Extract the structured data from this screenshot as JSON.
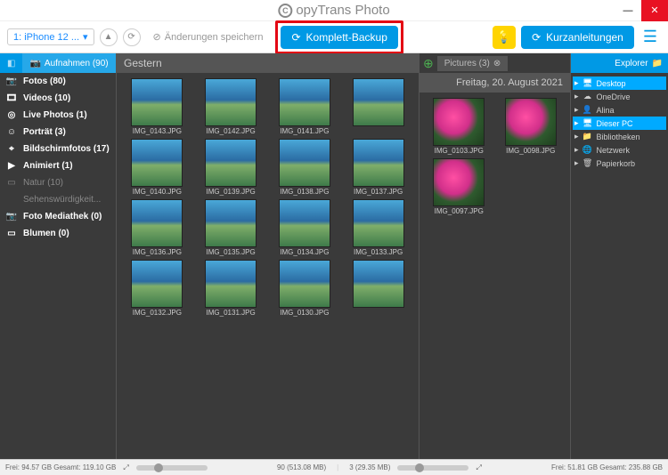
{
  "app": {
    "title": "opyTrans Photo",
    "logo": "C"
  },
  "titlebar": {
    "min": "—",
    "close": "✕"
  },
  "toolbar": {
    "device": "1: iPhone 12 ...",
    "save": "Änderungen speichern",
    "backup": "Komplett-Backup",
    "guide": "Kurzanleitungen"
  },
  "tabs": {
    "albums": "Aufnahmen (90)"
  },
  "sidebar": [
    {
      "icon": "📷",
      "label": "Fotos (80)",
      "cls": "bold"
    },
    {
      "icon": "🎞",
      "label": "Videos (10)",
      "cls": "bold"
    },
    {
      "icon": "◎",
      "label": "Live Photos (1)",
      "cls": "bold"
    },
    {
      "icon": "☺",
      "label": "Porträt (3)",
      "cls": "bold"
    },
    {
      "icon": "⌖",
      "label": "Bildschirmfotos (17)",
      "cls": "bold"
    },
    {
      "icon": "▶",
      "label": "Animiert (1)",
      "cls": "bold"
    },
    {
      "icon": "▭",
      "label": "Natur (10)",
      "cls": "dim"
    },
    {
      "icon": "",
      "label": "Sehenswürdigkeit...",
      "cls": "dim"
    },
    {
      "icon": "📷",
      "label": "Foto Mediathek (0)",
      "cls": "bold"
    },
    {
      "icon": "▭",
      "label": "Blumen (0)",
      "cls": "bold"
    }
  ],
  "gallery_left": {
    "header": "Gestern",
    "items": [
      "IMG_0143.JPG",
      "IMG_0142.JPG",
      "IMG_0141.JPG",
      "",
      "IMG_0140.JPG",
      "IMG_0139.JPG",
      "IMG_0138.JPG",
      "IMG_0137.JPG",
      "IMG_0136.JPG",
      "IMG_0135.JPG",
      "IMG_0134.JPG",
      "IMG_0133.JPG",
      "IMG_0132.JPG",
      "IMG_0131.JPG",
      "IMG_0130.JPG",
      ""
    ]
  },
  "gallery_right": {
    "tab": "Pictures (3)",
    "header": "Freitag, 20. August 2021",
    "items": [
      {
        "label": "IMG_0103.JPG",
        "type": "flower"
      },
      {
        "label": "IMG_0098.JPG",
        "type": "flower"
      },
      {
        "label": "IMG_0097.JPG",
        "type": "flower"
      }
    ]
  },
  "explorer": {
    "tab": "Explorer",
    "items": [
      {
        "icon": "🖥",
        "label": "Desktop",
        "sel": true
      },
      {
        "icon": "☁",
        "label": "OneDrive"
      },
      {
        "icon": "👤",
        "label": "Alina"
      },
      {
        "icon": "🖥",
        "label": "Dieser PC",
        "sel": true
      },
      {
        "icon": "📁",
        "label": "Bibliotheken"
      },
      {
        "icon": "🌐",
        "label": "Netzwerk"
      },
      {
        "icon": "🗑",
        "label": "Papierkorb"
      }
    ]
  },
  "status": {
    "left_free": "Frei: 94.57 GB Gesamt: 119.10 GB",
    "center": "90 (513.08 MB)",
    "right_count": "3 (29.35 MB)",
    "right_free": "Frei: 51.81 GB Gesamt: 235.88 GB"
  }
}
